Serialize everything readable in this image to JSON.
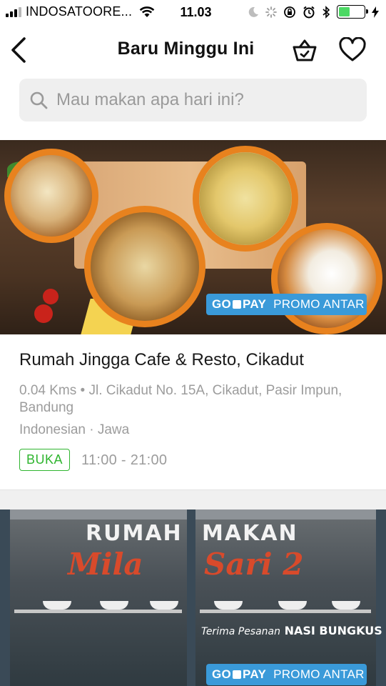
{
  "status_bar": {
    "carrier": "INDOSATOORE...",
    "time": "11.03",
    "battery_level": 0.45
  },
  "header": {
    "title": "Baru Minggu Ini"
  },
  "search": {
    "placeholder": "Mau makan apa hari ini?"
  },
  "colors": {
    "accent_green": "#2fb52f",
    "gopay_blue": "#3a9ad9",
    "plate_orange": "#e8821e"
  },
  "restaurants": [
    {
      "promo": {
        "brand_left": "GO",
        "brand_right": "PAY",
        "label": "PROMO ANTAR"
      },
      "name": "Rumah Jingga Cafe & Resto, Cikadut",
      "address": "0.04 Kms • Jl. Cikadut No. 15A, Cikadut, Pasir Impun, Bandung",
      "cuisine": "Indonesian · Jawa",
      "status": "BUKA",
      "hours": "11:00 - 21:00"
    },
    {
      "sign": {
        "line1_left": "RUMAH",
        "line1_right": "MAKAN",
        "script_left": "Mila",
        "script_right": "Sari 2",
        "sub_small": "Terima Pesanan",
        "sub_big": "NASI BUNGKUS"
      },
      "promo": {
        "brand_left": "GO",
        "brand_right": "PAY",
        "label": "PROMO ANTAR"
      }
    }
  ]
}
